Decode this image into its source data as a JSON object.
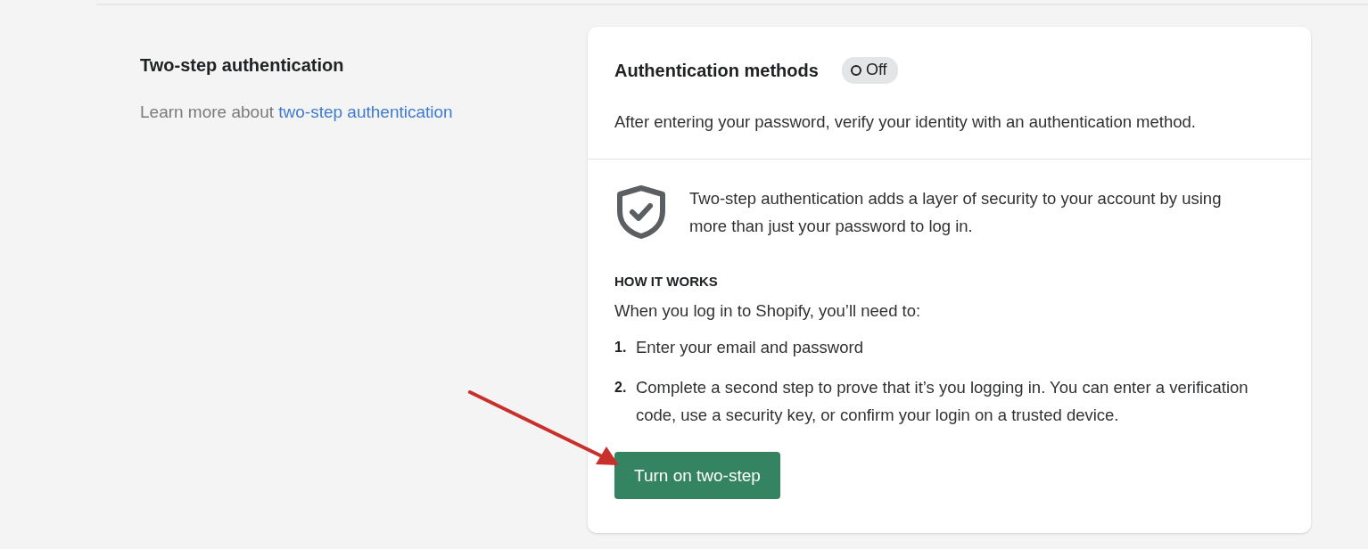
{
  "section": {
    "title": "Two-step authentication",
    "learn_more": {
      "text": "Learn more about",
      "link": "two-step authentication"
    }
  },
  "card": {
    "title": "Authentication methods",
    "status": {
      "label": "Off",
      "on": false
    },
    "description": "After entering your password, verify your identity with an authentication method.",
    "intro": "Two-step authentication adds a layer of security to your account by using more than just your password to log in.",
    "heading": "HOW IT WORKS",
    "lead": "When you log in to Shopify, you’ll need to:",
    "steps": [
      {
        "number": "1.",
        "text": "Enter your email and password"
      },
      {
        "number": "2.",
        "text": "Complete a second step to prove that it’s you logging in. You can enter a verification code, use a security key, or confirm your login on a trusted device."
      }
    ],
    "button": "Turn on two-step"
  }
}
